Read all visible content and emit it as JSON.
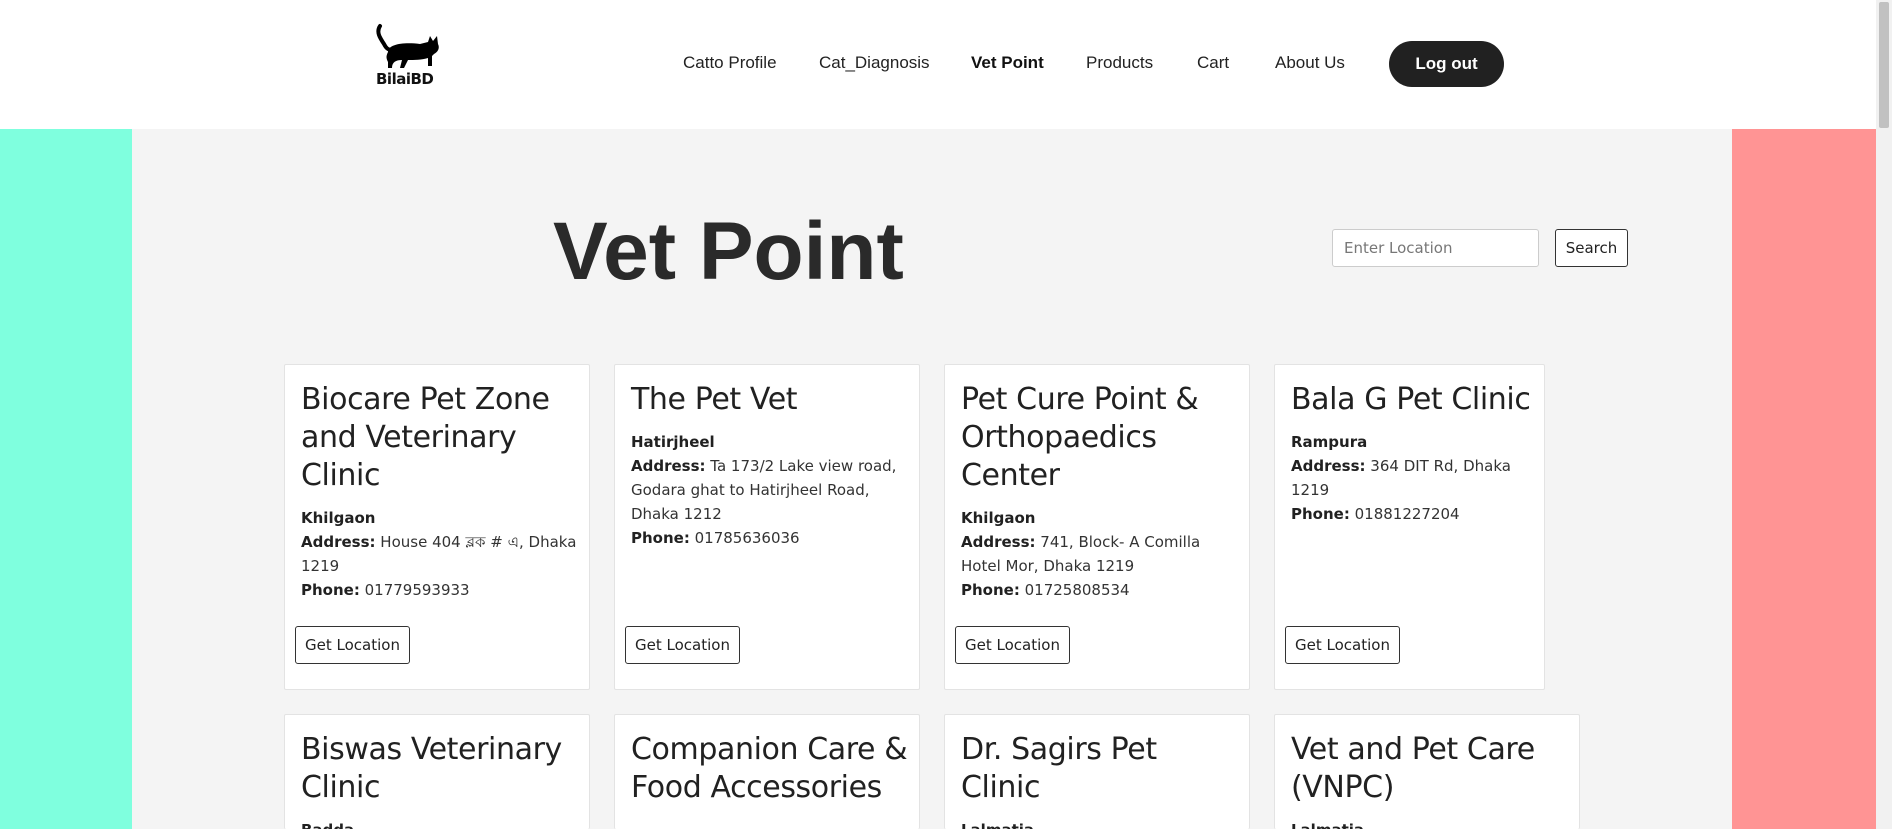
{
  "brand": {
    "name": "BilaiBD",
    "logo_icon": "black-cat-icon"
  },
  "nav": {
    "items": [
      {
        "label": "Catto Profile"
      },
      {
        "label": "Cat_Diagnosis"
      },
      {
        "label": "Vet Point",
        "active": true
      },
      {
        "label": "Products"
      },
      {
        "label": "Cart"
      },
      {
        "label": "About Us"
      }
    ],
    "logout_label": "Log out"
  },
  "page": {
    "title": "Vet Point"
  },
  "search": {
    "placeholder": "Enter Location",
    "button_label": "Search"
  },
  "colors": {
    "left_bar": "#7fffde",
    "right_bar": "#ff9494",
    "main_bg": "#f4f4f4",
    "button_dark": "#212121"
  },
  "clinics": [
    {
      "name": "Biocare Pet Zone and Veterinary Clinic",
      "area": "Khilgaon",
      "address": "House 404 ব্লক # এ, Dhaka 1219",
      "phone": "01779593933",
      "button": "Get Location"
    },
    {
      "name": "The Pet Vet",
      "area": "Hatirjheel",
      "address": "Ta 173/2 Lake view road, Godara ghat to Hatirjheel Road, Dhaka 1212",
      "phone": "01785636036",
      "button": "Get Location"
    },
    {
      "name": "Pet Cure Point & Orthopaedics Center",
      "area": "Khilgaon",
      "address": "741, Block- A Comilla Hotel Mor, Dhaka 1219",
      "phone": "01725808534",
      "button": "Get Location"
    },
    {
      "name": "Bala G Pet Clinic",
      "area": "Rampura",
      "address": "364 DIT Rd, Dhaka 1219",
      "phone": "01881227204",
      "button": "Get Location"
    },
    {
      "name": "Biswas Veterinary Clinic",
      "area": "Badda"
    },
    {
      "name": "Companion Care & Food Accessories"
    },
    {
      "name": "Dr. Sagirs Pet Clinic",
      "area": "Lalmatia"
    },
    {
      "name": "Vet and Pet Care (VNPC)",
      "area": "Lalmatia"
    }
  ],
  "labels": {
    "address": "Address:",
    "phone": "Phone:"
  }
}
